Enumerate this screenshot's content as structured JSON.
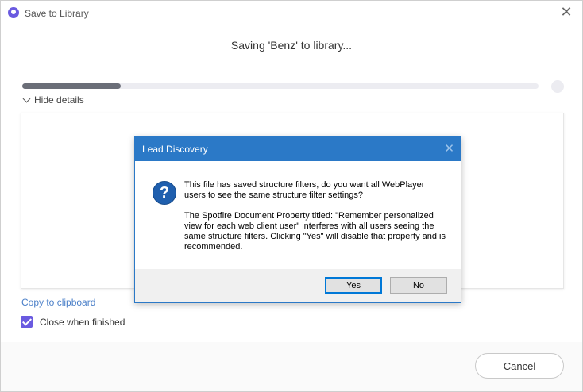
{
  "window": {
    "title": "Save to Library",
    "accent_color": "#6a5ae0"
  },
  "status": {
    "saving_text": "Saving 'Benz' to library...",
    "progress": 0.19
  },
  "details": {
    "toggle_label": "Hide details"
  },
  "actions": {
    "copy_label": "Copy to clipboard",
    "close_when_finished_label": "Close when finished",
    "close_when_finished_checked": true,
    "cancel_label": "Cancel"
  },
  "dialog": {
    "title": "Lead Discovery",
    "title_color": "#2b79c7",
    "icon": "question-icon",
    "message_1": "This file has saved structure filters, do you want all WebPlayer users to see the same structure filter settings?",
    "message_2": "The Spotfire Document Property titled: \"Remember personalized view for each web client user\" interferes with all users seeing the same structure filters.  Clicking \"Yes\" will disable that property and is recommended.",
    "yes_label": "Yes",
    "no_label": "No"
  }
}
